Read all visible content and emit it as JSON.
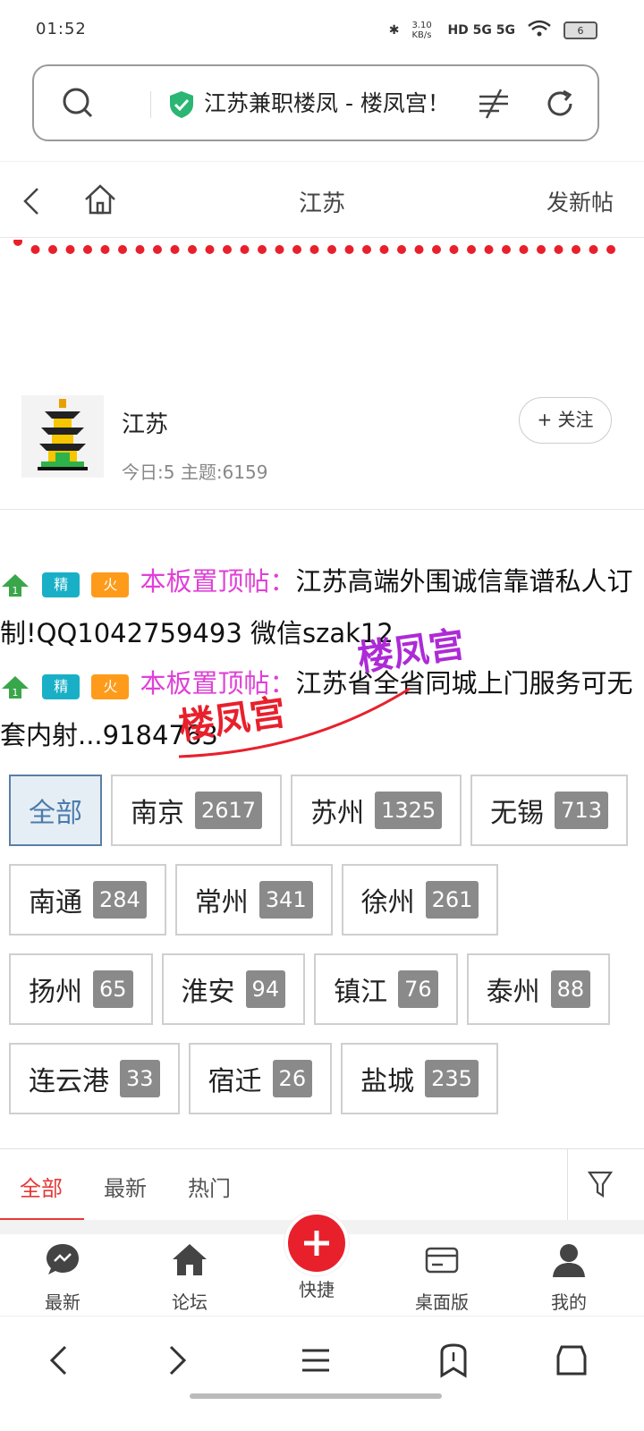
{
  "status_bar": {
    "time": "01:52",
    "speed": "3.10 KB/s",
    "network": "HD 5G 5G",
    "battery": "6"
  },
  "browser": {
    "url_title": "江苏兼职楼凤 - 楼凤宫！"
  },
  "nav": {
    "title": "江苏",
    "new_post": "发新帖"
  },
  "forum": {
    "name": "江苏",
    "stats": "今日:5 主题:6159",
    "follow": "+ 关注"
  },
  "pinned": [
    {
      "badge_up": "1",
      "badge_jing": "精",
      "badge_huo": "火",
      "label": "本板置顶帖：",
      "text": "江苏高端外围诚信靠谱私人订制!QQ1042759493 微信szak12"
    },
    {
      "badge_up": "1",
      "badge_jing": "精",
      "badge_huo": "火",
      "label": "本板置顶帖：",
      "text": "江苏省全省同城上门服务可无套内射...9184763"
    }
  ],
  "watermark": {
    "text1": "楼凤宫",
    "text2": "楼凤宫"
  },
  "cities": [
    [
      {
        "name": "全部",
        "count": null,
        "active": true
      },
      {
        "name": "南京",
        "count": "2617"
      },
      {
        "name": "苏州",
        "count": "1325"
      },
      {
        "name": "无锡",
        "count": "713"
      }
    ],
    [
      {
        "name": "南通",
        "count": "284"
      },
      {
        "name": "常州",
        "count": "341"
      },
      {
        "name": "徐州",
        "count": "261"
      }
    ],
    [
      {
        "name": "扬州",
        "count": "65"
      },
      {
        "name": "淮安",
        "count": "94"
      },
      {
        "name": "镇江",
        "count": "76"
      },
      {
        "name": "泰州",
        "count": "88"
      }
    ],
    [
      {
        "name": "连云港",
        "count": "33"
      },
      {
        "name": "宿迁",
        "count": "26"
      },
      {
        "name": "盐城",
        "count": "235"
      }
    ]
  ],
  "sort_tabs": [
    "全部",
    "最新",
    "热门"
  ],
  "app_nav": [
    "最新",
    "论坛",
    "快捷",
    "桌面版",
    "我的"
  ],
  "colors": {
    "accent": "#e53935",
    "pin_label": "#e040d8",
    "badge_jing": "#19b0c7",
    "badge_huo": "#ff9b1a"
  }
}
